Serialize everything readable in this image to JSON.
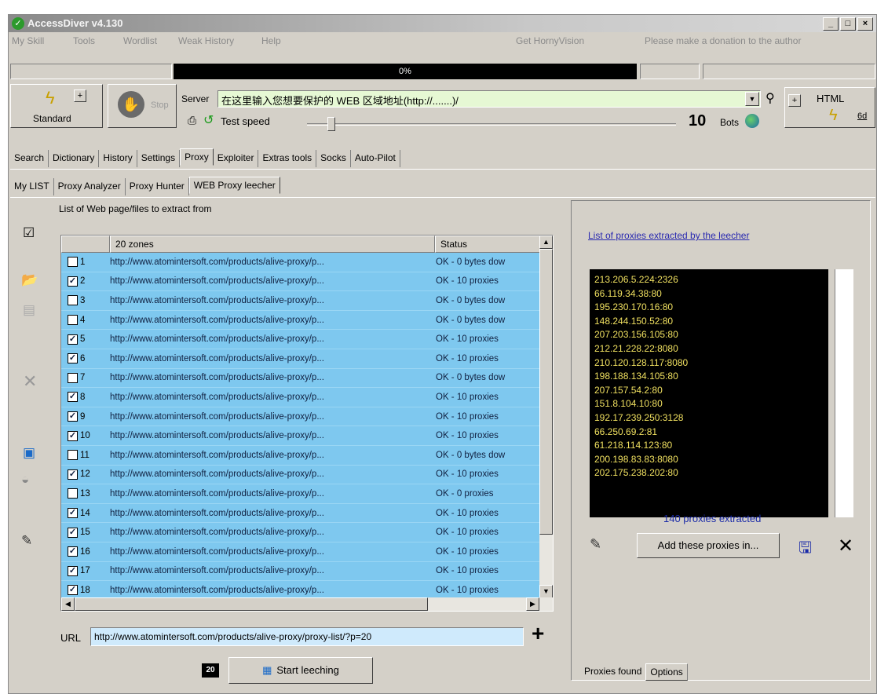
{
  "app": {
    "title": "AccessDiver v4.130"
  },
  "menu": [
    "My Skill",
    "Tools",
    "Wordlist",
    "Weak History",
    "Help"
  ],
  "menu_right": [
    "Get HornyVision",
    "Please make a donation to the author"
  ],
  "progress": {
    "label": "0%",
    "value": 0
  },
  "toolbar": {
    "standard_label": "Standard",
    "stop_label": "Stop",
    "server_label": "Server",
    "server_value": "在这里输入您想要保护的 WEB 区域地址(http://.......)/",
    "test_speed_label": "Test speed",
    "bots_count": "10",
    "bots_label": "Bots",
    "html_label": "HTML",
    "small_label": "6d"
  },
  "main_tabs": [
    "Search",
    "Dictionary",
    "History",
    "Settings",
    "Proxy",
    "Exploiter",
    "Extras tools",
    "Socks",
    "Auto-Pilot"
  ],
  "main_tab_selected": "Proxy",
  "sub_tabs": [
    "My LIST",
    "Proxy Analyzer",
    "Proxy Hunter",
    "WEB Proxy leecher"
  ],
  "sub_tab_selected": "WEB Proxy leecher",
  "leecher": {
    "list_title": "List of Web page/files to extract from",
    "columns": [
      "20 zones",
      "Status"
    ],
    "rows": [
      {
        "num": "1",
        "checked": false,
        "url": "http://www.atomintersoft.com/products/alive-proxy/p...",
        "status": "OK - 0 bytes dow"
      },
      {
        "num": "2",
        "checked": true,
        "url": "http://www.atomintersoft.com/products/alive-proxy/p...",
        "status": "OK - 10 proxies"
      },
      {
        "num": "3",
        "checked": false,
        "url": "http://www.atomintersoft.com/products/alive-proxy/p...",
        "status": "OK - 0 bytes dow"
      },
      {
        "num": "4",
        "checked": false,
        "url": "http://www.atomintersoft.com/products/alive-proxy/p...",
        "status": "OK - 0 bytes dow"
      },
      {
        "num": "5",
        "checked": true,
        "url": "http://www.atomintersoft.com/products/alive-proxy/p...",
        "status": "OK - 10 proxies"
      },
      {
        "num": "6",
        "checked": true,
        "url": "http://www.atomintersoft.com/products/alive-proxy/p...",
        "status": "OK - 10 proxies"
      },
      {
        "num": "7",
        "checked": false,
        "url": "http://www.atomintersoft.com/products/alive-proxy/p...",
        "status": "OK - 0 bytes dow"
      },
      {
        "num": "8",
        "checked": true,
        "url": "http://www.atomintersoft.com/products/alive-proxy/p...",
        "status": "OK - 10 proxies"
      },
      {
        "num": "9",
        "checked": true,
        "url": "http://www.atomintersoft.com/products/alive-proxy/p...",
        "status": "OK - 10 proxies"
      },
      {
        "num": "10",
        "checked": true,
        "url": "http://www.atomintersoft.com/products/alive-proxy/p...",
        "status": "OK - 10 proxies"
      },
      {
        "num": "11",
        "checked": false,
        "url": "http://www.atomintersoft.com/products/alive-proxy/p...",
        "status": "OK - 0 bytes dow"
      },
      {
        "num": "12",
        "checked": true,
        "url": "http://www.atomintersoft.com/products/alive-proxy/p...",
        "status": "OK - 10 proxies"
      },
      {
        "num": "13",
        "checked": false,
        "url": "http://www.atomintersoft.com/products/alive-proxy/p...",
        "status": "OK - 0 proxies"
      },
      {
        "num": "14",
        "checked": true,
        "url": "http://www.atomintersoft.com/products/alive-proxy/p...",
        "status": "OK - 10 proxies"
      },
      {
        "num": "15",
        "checked": true,
        "url": "http://www.atomintersoft.com/products/alive-proxy/p...",
        "status": "OK - 10 proxies"
      },
      {
        "num": "16",
        "checked": true,
        "url": "http://www.atomintersoft.com/products/alive-proxy/p...",
        "status": "OK - 10 proxies"
      },
      {
        "num": "17",
        "checked": true,
        "url": "http://www.atomintersoft.com/products/alive-proxy/p...",
        "status": "OK - 10 proxies"
      },
      {
        "num": "18",
        "checked": true,
        "url": "http://www.atomintersoft.com/products/alive-proxy/p...",
        "status": "OK - 10 proxies"
      }
    ],
    "url_label": "URL",
    "url_value": "http://www.atomintersoft.com/products/alive-proxy/proxy-list/?p=20",
    "count_badge": "20",
    "start_label": "Start leeching"
  },
  "proxies": {
    "link": "List of proxies extracted by the leecher",
    "items": [
      "213.206.5.224:2326",
      "66.119.34.38:80",
      "195.230.170.16:80",
      "148.244.150.52:80",
      "207.203.156.105:80",
      "212.21.228.22:8080",
      "210.120.128.117:8080",
      "198.188.134.105:80",
      "207.157.54.2:80",
      "151.8.104.10:80",
      "192.17.239.250:3128",
      "66.250.69.2:81",
      "61.218.114.123:80",
      "200.198.83.83:8080",
      "202.175.238.202:80"
    ],
    "count_text": "140 proxies extracted",
    "add_label": "Add these proxies in...",
    "bottom_tabs": [
      "Proxies found",
      "Options"
    ]
  },
  "colors": {
    "row_bg": "#7ec8ef",
    "list_text": "#f0e060",
    "progress_bg": "#000000"
  }
}
